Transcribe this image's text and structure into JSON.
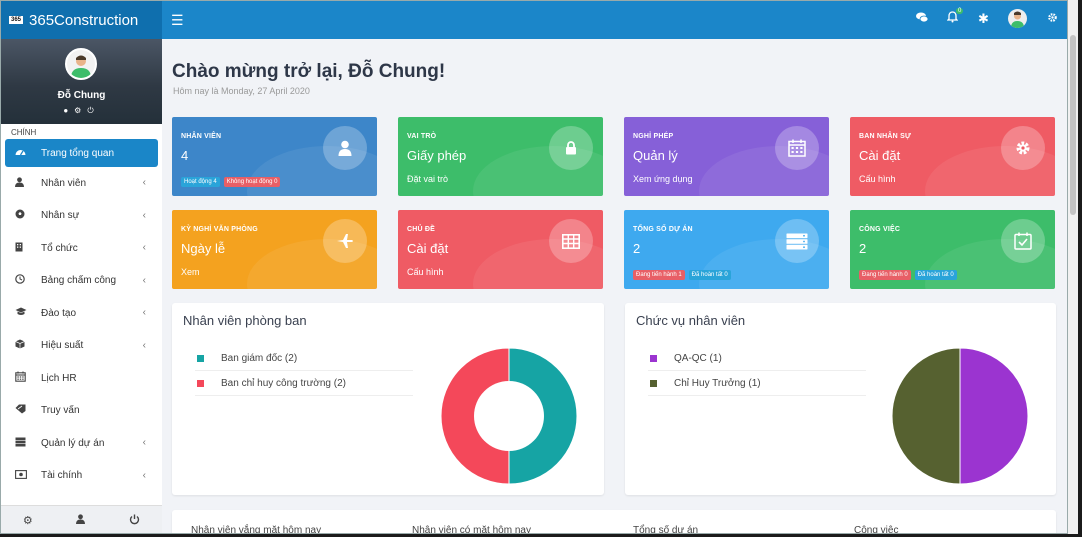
{
  "topbar": {
    "logo_text": "365",
    "brand": "365Construction",
    "menu_icon": "hamburger-icon",
    "notification_count": "0",
    "icons": [
      "chat-icon",
      "bell-icon",
      "asterisk-icon",
      "avatar",
      "gear-icon"
    ]
  },
  "sidebar": {
    "user_name": "Đỗ Chung",
    "section_label": "CHÍNH",
    "items": [
      {
        "label": "Trang tổng quan",
        "icon": "dashboard-icon",
        "active": true,
        "chevron": false
      },
      {
        "label": "Nhân viên",
        "icon": "user-icon",
        "chevron": true
      },
      {
        "label": "Nhân sự",
        "icon": "soccer-icon",
        "chevron": true
      },
      {
        "label": "Tổ chức",
        "icon": "building-icon",
        "chevron": true
      },
      {
        "label": "Bảng chấm công",
        "icon": "clock-icon",
        "chevron": true
      },
      {
        "label": "Đào tạo",
        "icon": "graduation-cap-icon",
        "chevron": true
      },
      {
        "label": "Hiệu suất",
        "icon": "cube-icon",
        "chevron": true
      },
      {
        "label": "Lịch HR",
        "icon": "calendar-icon",
        "chevron": false
      },
      {
        "label": "Truy vấn",
        "icon": "tag-icon",
        "chevron": false
      },
      {
        "label": "Quản lý dự án",
        "icon": "server-icon",
        "chevron": true
      },
      {
        "label": "Tài chính",
        "icon": "money-icon",
        "chevron": true
      }
    ]
  },
  "main": {
    "greeting": "Chào mừng trở lại, Đỗ Chung!",
    "date_line": "Hôm nay là Monday, 27 April 2020"
  },
  "cards": [
    {
      "title": "NHÂN VIÊN",
      "value": "4",
      "sub": "",
      "badges": [
        {
          "text": "Hoạt động 4",
          "tone": "blue"
        },
        {
          "text": "Không hoạt động 0",
          "tone": "red"
        }
      ],
      "color": "#3d86c9",
      "icon": "user-icon"
    },
    {
      "title": "VAI TRÒ",
      "value": "Giấy phép",
      "sub": "Đặt vai trò",
      "badges": [],
      "color": "#3dbd6a",
      "icon": "lock-icon"
    },
    {
      "title": "NGHỈ PHÉP",
      "value": "Quản lý",
      "sub": "Xem ứng dụng",
      "badges": [],
      "color": "#8660d8",
      "icon": "calendar-icon"
    },
    {
      "title": "BAN NHÂN SỰ",
      "value": "Cài đặt",
      "sub": "Cấu hình",
      "badges": [],
      "color": "#ef5b64",
      "icon": "gear-icon"
    },
    {
      "title": "KỲ NGHỈ VĂN PHÒNG",
      "value": "Ngày lễ",
      "sub": "Xem",
      "badges": [],
      "color": "#f4a21f",
      "icon": "plane-icon"
    },
    {
      "title": "CHỦ ĐỀ",
      "value": "Cài đặt",
      "sub": "Cấu hình",
      "badges": [],
      "color": "#ef5b64",
      "icon": "table-icon"
    },
    {
      "title": "TỔNG SỐ DỰ ÁN",
      "value": "2",
      "sub": "",
      "badges": [
        {
          "text": "Đang tiến hành 1",
          "tone": "red"
        },
        {
          "text": "Đã hoàn tất 0",
          "tone": "blue"
        }
      ],
      "color": "#3ea9ef",
      "icon": "server-icon"
    },
    {
      "title": "CÔNG VIỆC",
      "value": "2",
      "sub": "",
      "badges": [
        {
          "text": "Đang tiến hành 0",
          "tone": "red"
        },
        {
          "text": "Đã hoàn tất 0",
          "tone": "blue"
        }
      ],
      "color": "#3dbd6a",
      "icon": "calendar-check-icon"
    }
  ],
  "panels": [
    {
      "title": "Nhân viên phòng ban",
      "legend": [
        {
          "label": "Ban giám đốc (2)",
          "color": "#16a4a4"
        },
        {
          "label": "Ban chỉ huy công trường (2)",
          "color": "#f4485a"
        }
      ],
      "chart": {
        "type": "doughnut",
        "values": [
          2,
          2
        ],
        "colors": [
          "#16a4a4",
          "#f4485a"
        ]
      }
    },
    {
      "title": "Chức vụ nhân viên",
      "legend": [
        {
          "label": "QA-QC (1)",
          "color": "#9b34d0"
        },
        {
          "label": "Chỉ Huy Trưởng (1)",
          "color": "#566130"
        }
      ],
      "chart": {
        "type": "pie",
        "values": [
          1,
          1
        ],
        "colors": [
          "#9b34d0",
          "#566130"
        ]
      }
    }
  ],
  "bottom": {
    "labels": [
      "Nhân viên vắng mặt hôm nay",
      "Nhân viên có mặt hôm nay",
      "Tổng số dự án",
      "Công việc"
    ]
  },
  "chart_data": [
    {
      "type": "pie",
      "title": "Nhân viên phòng ban",
      "categories": [
        "Ban giám đốc",
        "Ban chỉ huy công trường"
      ],
      "values": [
        2,
        2
      ]
    },
    {
      "type": "pie",
      "title": "Chức vụ nhân viên",
      "categories": [
        "QA-QC",
        "Chỉ Huy Trưởng"
      ],
      "values": [
        1,
        1
      ]
    }
  ]
}
